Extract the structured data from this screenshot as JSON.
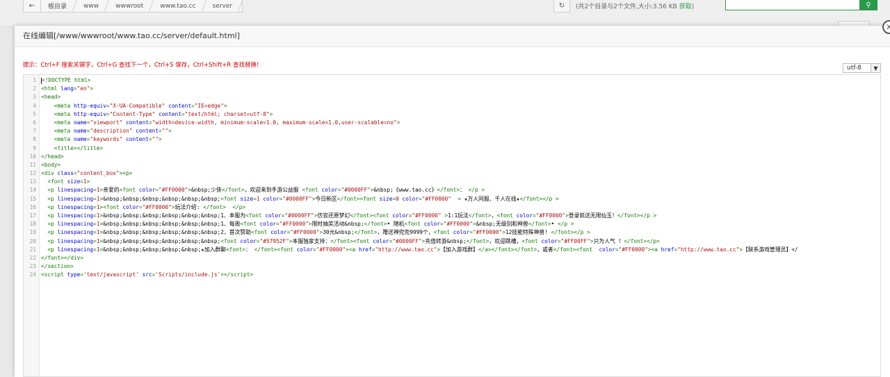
{
  "breadcrumb": {
    "back_icon": "arrow-left-icon",
    "items": [
      "根目录",
      "www",
      "wwwroot",
      "www.tao.cc",
      "server"
    ]
  },
  "dir_info": {
    "text": "(共2个目录与2个文件,大小:3.56 KB ",
    "link": "获取",
    "close": ")"
  },
  "modal": {
    "title": "在线编辑[/www/wwwroot/www.tao.cc/server/default.html]",
    "hint": "提示：Ctrl+F 搜索关键字，Ctrl+G 查找下一个，Ctrl+S 保存，Ctrl+Shift+R 查找替换!",
    "encoding": "utf-8",
    "close_icon": "close-icon"
  },
  "editor": {
    "lines": [
      {
        "n": "1",
        "parts": [
          [
            "t",
            "<!DOCTYPE html>"
          ]
        ],
        "cursor": true
      },
      {
        "n": "2",
        "parts": [
          [
            "t",
            "<html "
          ],
          [
            "a",
            "lang"
          ],
          [
            "t",
            "="
          ],
          [
            "s",
            "\"en\""
          ],
          [
            "t",
            ">"
          ]
        ]
      },
      {
        "n": "3",
        "parts": [
          [
            "t",
            "<head>"
          ]
        ]
      },
      {
        "n": "4",
        "parts": [
          [
            "x",
            "    "
          ],
          [
            "t",
            "<meta "
          ],
          [
            "a",
            "http-equiv"
          ],
          [
            "t",
            "="
          ],
          [
            "s",
            "\"X-UA-Compatible\""
          ],
          [
            "t",
            " "
          ],
          [
            "a",
            "content"
          ],
          [
            "t",
            "="
          ],
          [
            "s",
            "\"IE=edge\""
          ],
          [
            "t",
            ">"
          ]
        ]
      },
      {
        "n": "5",
        "parts": [
          [
            "x",
            "    "
          ],
          [
            "t",
            "<meta "
          ],
          [
            "a",
            "http-equiv"
          ],
          [
            "t",
            "="
          ],
          [
            "s",
            "\"Content-Type\""
          ],
          [
            "t",
            " "
          ],
          [
            "a",
            "content"
          ],
          [
            "t",
            "="
          ],
          [
            "s",
            "\"text/html; charset=utf-8\""
          ],
          [
            "t",
            ">"
          ]
        ]
      },
      {
        "n": "6",
        "parts": [
          [
            "x",
            "    "
          ],
          [
            "t",
            "<meta "
          ],
          [
            "a",
            "name"
          ],
          [
            "t",
            "="
          ],
          [
            "s",
            "\"viewport\""
          ],
          [
            "t",
            " "
          ],
          [
            "a",
            "content"
          ],
          [
            "t",
            "="
          ],
          [
            "s",
            "\"width=device-width, minimum-scale=1.0, maximum-scale=1.0,user-scalable=no\""
          ],
          [
            "t",
            ">"
          ]
        ]
      },
      {
        "n": "7",
        "parts": [
          [
            "x",
            "    "
          ],
          [
            "t",
            "<meta "
          ],
          [
            "a",
            "name"
          ],
          [
            "t",
            "="
          ],
          [
            "s",
            "\"description\""
          ],
          [
            "t",
            " "
          ],
          [
            "a",
            "content"
          ],
          [
            "t",
            "="
          ],
          [
            "s",
            "\"\""
          ],
          [
            "t",
            ">"
          ]
        ]
      },
      {
        "n": "8",
        "parts": [
          [
            "x",
            "    "
          ],
          [
            "t",
            "<meta "
          ],
          [
            "a",
            "name"
          ],
          [
            "t",
            "="
          ],
          [
            "s",
            "\"keywords\""
          ],
          [
            "t",
            " "
          ],
          [
            "a",
            "content"
          ],
          [
            "t",
            "="
          ],
          [
            "s",
            "\"\""
          ],
          [
            "t",
            ">"
          ]
        ]
      },
      {
        "n": "9",
        "parts": [
          [
            "x",
            "    "
          ],
          [
            "t",
            "<title></title>"
          ]
        ]
      },
      {
        "n": "10",
        "parts": [
          [
            "t",
            "</head>"
          ]
        ]
      },
      {
        "n": "11",
        "parts": [
          [
            "t",
            "<body>"
          ]
        ]
      },
      {
        "n": "12",
        "parts": [
          [
            "t",
            "<div "
          ],
          [
            "a",
            "class"
          ],
          [
            "t",
            "="
          ],
          [
            "s",
            "\"content_box\""
          ],
          [
            "t",
            "><p>"
          ]
        ]
      },
      {
        "n": "13",
        "parts": [
          [
            "x",
            "  "
          ],
          [
            "t",
            "<font "
          ],
          [
            "a",
            "size"
          ],
          [
            "t",
            "="
          ],
          [
            "s",
            "1"
          ],
          [
            "t",
            ">"
          ]
        ]
      },
      {
        "n": "14",
        "parts": [
          [
            "x",
            "  "
          ],
          [
            "t",
            "<p "
          ],
          [
            "a",
            "linespacing"
          ],
          [
            "t",
            "="
          ],
          [
            "s",
            "1"
          ],
          [
            "t",
            ">"
          ],
          [
            "x",
            "亲爱的"
          ],
          [
            "t",
            "<font "
          ],
          [
            "a",
            "color"
          ],
          [
            "t",
            "="
          ],
          [
            "s",
            "\"#FF0000\""
          ],
          [
            "t",
            ">"
          ],
          [
            "x",
            "&nbsp;少侠"
          ],
          [
            "t",
            "</font>"
          ],
          [
            "x",
            "，欢迎来到手游公益服 "
          ],
          [
            "t",
            "<font "
          ],
          [
            "a",
            "color"
          ],
          [
            "t",
            "="
          ],
          [
            "s",
            "\"#0000FF\""
          ],
          [
            "t",
            ">"
          ],
          [
            "x",
            "&nbsp;《www.tao.cc》"
          ],
          [
            "t",
            "</font>"
          ],
          [
            "x",
            "： "
          ],
          [
            "t",
            "</p >"
          ]
        ]
      },
      {
        "n": "15",
        "parts": [
          [
            "x",
            "  "
          ],
          [
            "t",
            "<p "
          ],
          [
            "a",
            "linespacing"
          ],
          [
            "t",
            "="
          ],
          [
            "s",
            "1"
          ],
          [
            "t",
            ">"
          ],
          [
            "x",
            "&nbsp;&nbsp;&nbsp;&nbsp;&nbsp;&nbsp;"
          ],
          [
            "t",
            "<font "
          ],
          [
            "a",
            "size"
          ],
          [
            "t",
            "="
          ],
          [
            "s",
            "1"
          ],
          [
            "t",
            " "
          ],
          [
            "a",
            "color"
          ],
          [
            "t",
            "="
          ],
          [
            "s",
            "\"#0000FF\""
          ],
          [
            "t",
            ">"
          ],
          [
            "x",
            "今日新区"
          ],
          [
            "t",
            "</font><font "
          ],
          [
            "a",
            "size"
          ],
          [
            "t",
            "="
          ],
          [
            "s",
            "0"
          ],
          [
            "t",
            " "
          ],
          [
            "a",
            "color"
          ],
          [
            "t",
            "="
          ],
          [
            "s",
            "\"#FF0000\""
          ],
          [
            "t",
            "  >"
          ],
          [
            "x",
            " ★万人同服、千人在线★"
          ],
          [
            "t",
            "</font></p >"
          ]
        ]
      },
      {
        "n": "16",
        "parts": [
          [
            "x",
            "  "
          ],
          [
            "t",
            "<p "
          ],
          [
            "a",
            "linespacing"
          ],
          [
            "t",
            "="
          ],
          [
            "s",
            "1"
          ],
          [
            "t",
            "><font "
          ],
          [
            "a",
            "color"
          ],
          [
            "t",
            "="
          ],
          [
            "s",
            "\"#FF0000\""
          ],
          [
            "t",
            ">"
          ],
          [
            "x",
            "玩法介绍: "
          ],
          [
            "t",
            "</font>  </p>"
          ]
        ]
      },
      {
        "n": "17",
        "parts": [
          [
            "x",
            "  "
          ],
          [
            "t",
            "<p "
          ],
          [
            "a",
            "linespacing"
          ],
          [
            "t",
            "="
          ],
          [
            "s",
            "1"
          ],
          [
            "t",
            ">"
          ],
          [
            "x",
            "&nbsp;&nbsp;&nbsp;&nbsp;&nbsp;&nbsp;1、本服为"
          ],
          [
            "t",
            "<font "
          ],
          [
            "a",
            "color"
          ],
          [
            "t",
            "="
          ],
          [
            "s",
            "\"#0000FF\""
          ],
          [
            "t",
            ">"
          ],
          [
            "x",
            "仿官还原梦幻"
          ],
          [
            "t",
            "</font><font "
          ],
          [
            "a",
            "color"
          ],
          [
            "t",
            "="
          ],
          [
            "s",
            "\"#FF0000\""
          ],
          [
            "t",
            " >"
          ],
          [
            "x",
            "1:1玩法"
          ],
          [
            "t",
            "</font>"
          ],
          [
            "x",
            "，"
          ],
          [
            "t",
            "<font "
          ],
          [
            "a",
            "color"
          ],
          [
            "t",
            "="
          ],
          [
            "s",
            "\"#FF0000\""
          ],
          [
            "t",
            ">"
          ],
          [
            "x",
            "登录就送无限仙玉！"
          ],
          [
            "t",
            "</font></p >"
          ]
        ]
      },
      {
        "n": "18",
        "parts": [
          [
            "x",
            "  "
          ],
          [
            "t",
            "<p "
          ],
          [
            "a",
            "linespacing"
          ],
          [
            "t",
            "="
          ],
          [
            "s",
            "1"
          ],
          [
            "t",
            ">"
          ],
          [
            "x",
            "&nbsp;&nbsp;&nbsp;&nbsp;&nbsp;&nbsp;1、每周"
          ],
          [
            "t",
            "<font "
          ],
          [
            "a",
            "color"
          ],
          [
            "t",
            "="
          ],
          [
            "s",
            "\"#FF0000\""
          ],
          [
            "t",
            ">"
          ],
          [
            "x",
            "限时抽奖活动&nbsp;"
          ],
          [
            "t",
            "</font>"
          ],
          [
            "x",
            "• 随机"
          ],
          [
            "t",
            "<font "
          ],
          [
            "a",
            "color"
          ],
          [
            "t",
            "="
          ],
          [
            "s",
            "\"#FF0000\""
          ],
          [
            "t",
            ">"
          ],
          [
            "x",
            "&nbsp;无级别和神兽"
          ],
          [
            "t",
            "</font>"
          ],
          [
            "x",
            "• "
          ],
          [
            "t",
            "</p >"
          ]
        ]
      },
      {
        "n": "19",
        "parts": [
          [
            "x",
            "  "
          ],
          [
            "t",
            "<p "
          ],
          [
            "a",
            "linespacing"
          ],
          [
            "t",
            "="
          ],
          [
            "s",
            "1"
          ],
          [
            "t",
            ">"
          ],
          [
            "x",
            "&nbsp;&nbsp;&nbsp;&nbsp;&nbsp;&nbsp;2、首次赞助"
          ],
          [
            "t",
            "<font "
          ],
          [
            "a",
            "color"
          ],
          [
            "t",
            "="
          ],
          [
            "s",
            "\"#FF0000\""
          ],
          [
            "t",
            ">"
          ],
          [
            "x",
            "30元&nbsp;"
          ],
          [
            "t",
            "</font>"
          ],
          [
            "x",
            "，赠送神兜兜9999个，"
          ],
          [
            "t",
            "<font "
          ],
          [
            "a",
            "color"
          ],
          [
            "t",
            "="
          ],
          [
            "s",
            "\"#FF0000\""
          ],
          [
            "t",
            ">"
          ],
          [
            "x",
            "12技能特殊神兽! "
          ],
          [
            "t",
            "</font></p >"
          ]
        ]
      },
      {
        "n": "20",
        "parts": [
          [
            "x",
            "  "
          ],
          [
            "t",
            "<p "
          ],
          [
            "a",
            "linespacing"
          ],
          [
            "t",
            "="
          ],
          [
            "s",
            "1"
          ],
          [
            "t",
            ">"
          ],
          [
            "x",
            "&nbsp;&nbsp;&nbsp;&nbsp;&nbsp;&nbsp;"
          ],
          [
            "t",
            "<font "
          ],
          [
            "a",
            "color"
          ],
          [
            "t",
            "="
          ],
          [
            "s",
            "\"#57952F\""
          ],
          [
            "t",
            ">"
          ],
          [
            "x",
            "本服独家支持："
          ],
          [
            "t",
            "</font><font "
          ],
          [
            "a",
            "color"
          ],
          [
            "t",
            "="
          ],
          [
            "s",
            "\"#0000FF\""
          ],
          [
            "t",
            ">"
          ],
          [
            "x",
            "充值转游&nbsp;"
          ],
          [
            "t",
            "</font>"
          ],
          [
            "x",
            "，欢迎跳槽，"
          ],
          [
            "t",
            "<font "
          ],
          [
            "a",
            "color"
          ],
          [
            "t",
            "="
          ],
          [
            "s",
            "\"#FF00FF\""
          ],
          [
            "t",
            ">"
          ],
          [
            "x",
            "只为人气 ！"
          ],
          [
            "t",
            "</font></p>"
          ]
        ]
      },
      {
        "n": "21",
        "parts": [
          [
            "x",
            "  "
          ],
          [
            "t",
            "<p "
          ],
          [
            "a",
            "linespacing"
          ],
          [
            "t",
            "="
          ],
          [
            "s",
            "1"
          ],
          [
            "t",
            ">"
          ],
          [
            "x",
            "&nbsp;&nbsp;&nbsp;&nbsp;&nbsp;★加入群聊"
          ],
          [
            "t",
            "<font>"
          ],
          [
            "x",
            "： "
          ],
          [
            "t",
            "</font><font "
          ],
          [
            "a",
            "color"
          ],
          [
            "t",
            "="
          ],
          [
            "s",
            "\"#FF0000\""
          ],
          [
            "t",
            "><a "
          ],
          [
            "a",
            "href"
          ],
          [
            "t",
            "="
          ],
          [
            "s",
            "\"http://www.tao.cc\""
          ],
          [
            "t",
            ">"
          ],
          [
            "x",
            "【加入游戏群】"
          ],
          [
            "t",
            "</a></font></font>"
          ],
          [
            "x",
            "，或者"
          ],
          [
            "t",
            "</font><font  "
          ],
          [
            "a",
            "color"
          ],
          [
            "t",
            "="
          ],
          [
            "s",
            "\"#FF0000\""
          ],
          [
            "t",
            "><a "
          ],
          [
            "a",
            "href"
          ],
          [
            "t",
            "="
          ],
          [
            "s",
            "\"http://www.tao.cc\""
          ],
          [
            "t",
            ">"
          ],
          [
            "x",
            "【联系游戏管理员】</"
          ]
        ]
      },
      {
        "n": "22",
        "parts": [
          [
            "t",
            "</font></div>"
          ]
        ]
      },
      {
        "n": "23",
        "parts": [
          [
            "t",
            "</section>"
          ]
        ]
      },
      {
        "n": "24",
        "parts": [
          [
            "t",
            "<script "
          ],
          [
            "a",
            "type"
          ],
          [
            "t",
            "="
          ],
          [
            "s",
            "'text/javascript'"
          ],
          [
            "t",
            " "
          ],
          [
            "a",
            "src"
          ],
          [
            "t",
            "="
          ],
          [
            "s",
            "'Scripts/include.js'"
          ],
          [
            "t",
            "></"
          ],
          [
            "t",
            "script>"
          ]
        ]
      }
    ]
  }
}
